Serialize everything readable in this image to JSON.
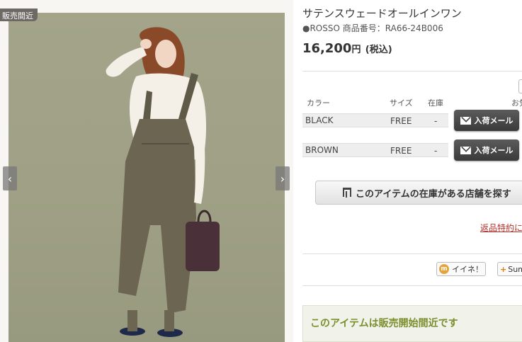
{
  "photo": {
    "badge": "販売間近",
    "prev_arrow": "‹",
    "next_arrow": "›"
  },
  "product": {
    "title": "サテンスウェードオールインワン",
    "brand": "●ROSSO",
    "code": "商品番号：RA66-24B006",
    "price": "16,200",
    "currency": "円",
    "tax": "(税込)"
  },
  "table": {
    "headers": {
      "color": "カラー",
      "size": "サイズ",
      "stock": "在庫",
      "extra": "お気"
    },
    "rows": [
      {
        "color": "BLACK",
        "size": "FREE",
        "stock": "-",
        "button": "入荷メール"
      },
      {
        "color": "BROWN",
        "size": "FREE",
        "stock": "-",
        "button": "入荷メール"
      }
    ]
  },
  "store_button": "このアイテムの在庫がある店舗を探す",
  "return_link": "返品特約に",
  "social": {
    "like": "イイネ！",
    "like_icon": "m",
    "sum": "Sum"
  },
  "notice": "このアイテムは販売開始間近です",
  "icons": {
    "mail": "envelope-icon",
    "store": "store-icon"
  },
  "colors": {
    "notice_text": "#7a8f2e",
    "link": "#b4322b",
    "mail_button": "#444444"
  }
}
